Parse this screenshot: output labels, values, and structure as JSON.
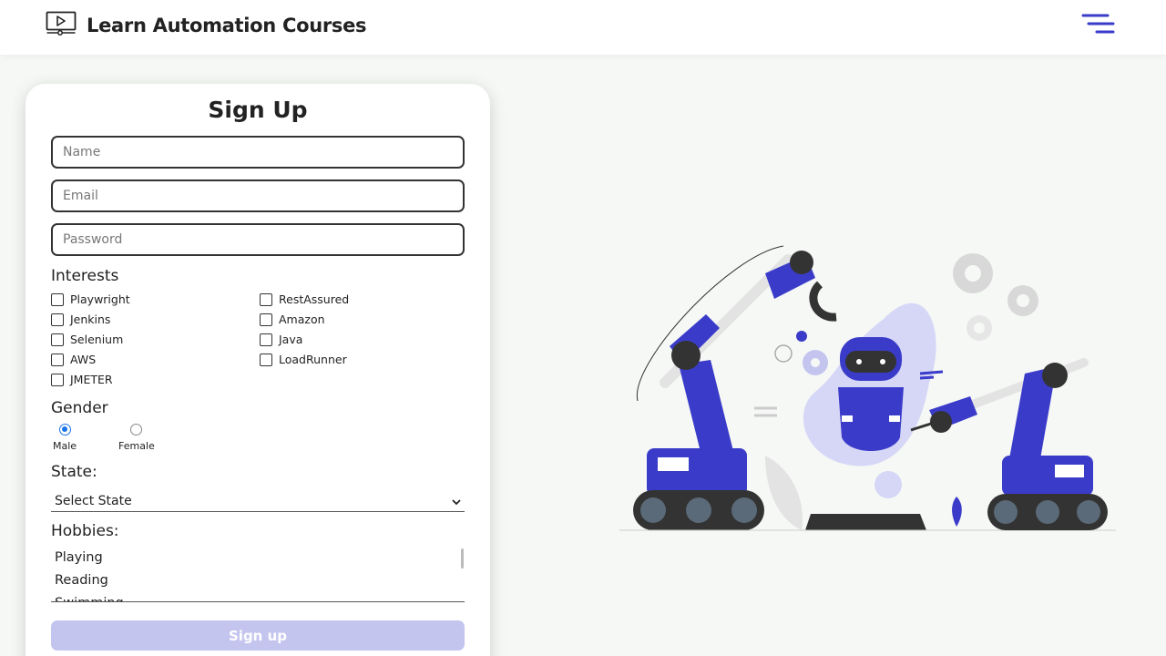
{
  "header": {
    "title": "Learn Automation Courses",
    "logo_icon": "video-monitor-icon",
    "menu_icon": "hamburger-menu-icon"
  },
  "colors": {
    "accent": "#3a3cc9",
    "button_disabled": "#c4c5ef",
    "radio_selected": "#1a73e8"
  },
  "form": {
    "title": "Sign Up",
    "name_placeholder": "Name",
    "email_placeholder": "Email",
    "password_placeholder": "Password",
    "interests_label": "Interests",
    "interests": [
      "Playwright",
      "RestAssured",
      "Jenkins",
      "Amazon",
      "Selenium",
      "Java",
      "AWS",
      "LoadRunner",
      "JMETER"
    ],
    "gender_label": "Gender",
    "gender_options": [
      "Male",
      "Female"
    ],
    "gender_selected": "Male",
    "state_label": "State:",
    "state_selected": "Select State",
    "hobbies_label": "Hobbies:",
    "hobbies": [
      "Playing",
      "Reading",
      "Swimming"
    ],
    "submit_label": "Sign up"
  }
}
